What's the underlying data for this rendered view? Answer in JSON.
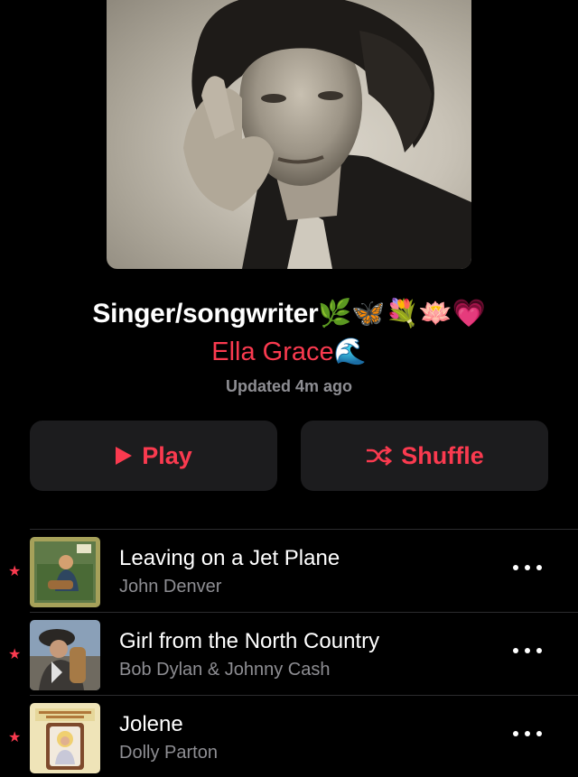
{
  "playlist": {
    "title": "Singer/songwriter🌿🦋💐🪷💗",
    "curator": "Ella Grace🌊",
    "updated": "Updated 4m ago",
    "cover_icon": "portrait-photo"
  },
  "actions": {
    "play_label": "Play",
    "shuffle_label": "Shuffle",
    "play_icon": "play-icon",
    "shuffle_icon": "shuffle-icon",
    "accent_color": "#fa3a4f"
  },
  "tracks": [
    {
      "title": "Leaving on a Jet Plane",
      "artist": "John Denver",
      "favorite": true
    },
    {
      "title": "Girl from the North Country",
      "artist": "Bob Dylan & Johnny Cash",
      "favorite": true
    },
    {
      "title": "Jolene",
      "artist": "Dolly Parton",
      "favorite": true
    }
  ]
}
